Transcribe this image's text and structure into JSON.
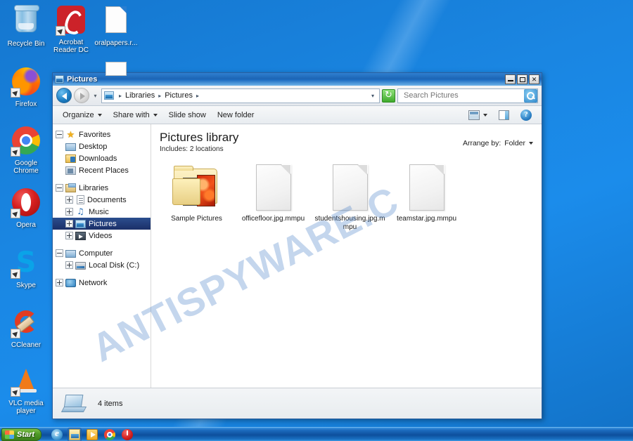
{
  "desktop": {
    "icons": [
      {
        "label": "Recycle Bin",
        "icon": "recycle-bin-icon",
        "shortcut": false
      },
      {
        "label": "Acrobat Reader DC",
        "icon": "acrobat-reader-icon",
        "shortcut": true
      },
      {
        "label": "oralpapers.r...",
        "icon": "document-icon",
        "shortcut": false
      },
      {
        "label": "Firefox",
        "icon": "firefox-icon",
        "shortcut": true
      },
      {
        "label": "Google Chrome",
        "icon": "chrome-icon",
        "shortcut": true
      },
      {
        "label": "Opera",
        "icon": "opera-icon",
        "shortcut": true
      },
      {
        "label": "Skype",
        "icon": "skype-icon",
        "shortcut": true
      },
      {
        "label": "CCleaner",
        "icon": "ccleaner-icon",
        "shortcut": true
      },
      {
        "label": "VLC media player",
        "icon": "vlc-icon",
        "shortcut": true
      }
    ],
    "watermark": "ANTISPYWARE.C"
  },
  "window": {
    "title": "Pictures",
    "buttons": {
      "minimize": "_",
      "maximize": "□",
      "close": "✕"
    },
    "address": {
      "crumbs": [
        "Libraries",
        "Pictures"
      ],
      "separator": "▸",
      "dropdown_caret": "▾",
      "refresh_label": "↻"
    },
    "search": {
      "placeholder": "Search Pictures",
      "value": ""
    },
    "toolbar": {
      "organize": "Organize",
      "share_with": "Share with",
      "slide_show": "Slide show",
      "new_folder": "New folder",
      "help": "?"
    }
  },
  "navpane": {
    "groups": [
      {
        "name": "Favorites",
        "expander": "minus",
        "icon": "star-icon",
        "items": [
          {
            "label": "Desktop",
            "icon": "desktop-icon",
            "expander": "none"
          },
          {
            "label": "Downloads",
            "icon": "downloads-icon",
            "expander": "none"
          },
          {
            "label": "Recent Places",
            "icon": "recent-places-icon",
            "expander": "none"
          }
        ]
      },
      {
        "name": "Libraries",
        "expander": "minus",
        "icon": "libraries-icon",
        "items": [
          {
            "label": "Documents",
            "icon": "documents-icon",
            "expander": "plus"
          },
          {
            "label": "Music",
            "icon": "music-icon",
            "expander": "plus"
          },
          {
            "label": "Pictures",
            "icon": "pictures-icon",
            "expander": "plus",
            "selected": true
          },
          {
            "label": "Videos",
            "icon": "videos-icon",
            "expander": "plus"
          }
        ]
      },
      {
        "name": "Computer",
        "expander": "minus",
        "icon": "computer-icon",
        "items": [
          {
            "label": "Local Disk (C:)",
            "icon": "disk-icon",
            "expander": "plus"
          }
        ]
      },
      {
        "name": "Network",
        "expander": "plus",
        "icon": "network-icon",
        "items": []
      }
    ]
  },
  "library": {
    "title": "Pictures library",
    "includes_label": "Includes:",
    "includes_value": "2 locations",
    "arrange_label": "Arrange by:",
    "arrange_value": "Folder"
  },
  "files": [
    {
      "name": "Sample Pictures",
      "type": "folder"
    },
    {
      "name": "officefloor.jpg.mmpu",
      "type": "file"
    },
    {
      "name": "studentshousing.jpg.mmpu",
      "type": "file"
    },
    {
      "name": "teamstar.jpg.mmpu",
      "type": "file"
    }
  ],
  "status": {
    "items_count": "4 items"
  },
  "taskbar": {
    "start_label": "Start",
    "quicklaunch": [
      {
        "name": "internet-explorer-icon"
      },
      {
        "name": "windows-explorer-icon"
      },
      {
        "name": "media-player-icon"
      },
      {
        "name": "chrome-icon"
      },
      {
        "name": "power-icon"
      }
    ]
  }
}
